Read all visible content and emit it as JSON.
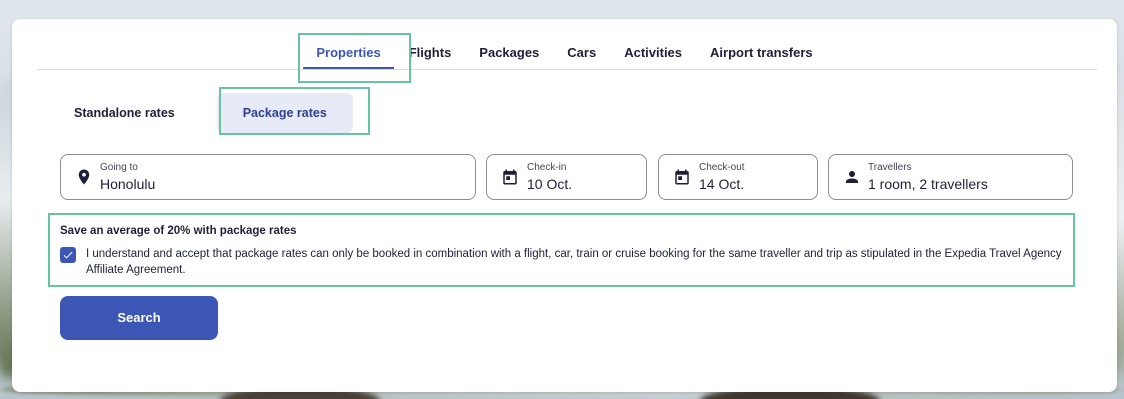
{
  "tabs": [
    {
      "label": "Properties",
      "active": true
    },
    {
      "label": "Flights",
      "active": false
    },
    {
      "label": "Packages",
      "active": false
    },
    {
      "label": "Cars",
      "active": false
    },
    {
      "label": "Activities",
      "active": false
    },
    {
      "label": "Airport transfers",
      "active": false
    }
  ],
  "rate_toggle": {
    "standalone_label": "Standalone rates",
    "package_label": "Package rates",
    "selected": "package"
  },
  "fields": {
    "going_to": {
      "label": "Going to",
      "value": "Honolulu",
      "icon": "map-pin-icon"
    },
    "check_in": {
      "label": "Check-in",
      "value": "10 Oct.",
      "icon": "calendar-icon"
    },
    "check_out": {
      "label": "Check-out",
      "value": "14 Oct.",
      "icon": "calendar-icon"
    },
    "travellers": {
      "label": "Travellers",
      "value": "1 room, 2 travellers",
      "icon": "person-icon"
    }
  },
  "package_notice": {
    "title": "Save an average of 20% with package rates",
    "checked": true,
    "agreement_text": "I understand and accept that package rates can only be booked in combination with a flight, car, train or cruise booking for the same traveller and trip as stipulated in the Expedia Travel Agency Affiliate Agreement."
  },
  "search_button": {
    "label": "Search"
  },
  "colors": {
    "accent": "#3b56b5",
    "selected_bg": "#e6ebf7",
    "highlight_outline": "#67c4a0",
    "text": "#1f1f3a"
  }
}
